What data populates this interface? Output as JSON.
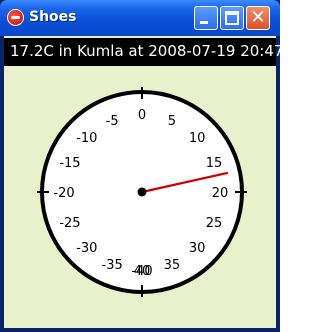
{
  "window": {
    "title": "Shoes",
    "title_icon": "app-logo-icon",
    "buttons": {
      "minimize": "minimize-icon",
      "maximize": "maximize-icon",
      "close": "close-icon"
    }
  },
  "header": {
    "text": "17.2C in Kumla at 2008-07-19 20:47"
  },
  "gauge": {
    "min": -40,
    "max": 40,
    "value": 17.2,
    "labels": [
      "-40",
      "-35",
      "-30",
      "-25",
      "-20",
      "-15",
      "-10",
      "-5",
      "0",
      "5",
      "10",
      "15",
      "20",
      "25",
      "30",
      "35",
      "40"
    ],
    "needle_color": "#cc0000"
  }
}
